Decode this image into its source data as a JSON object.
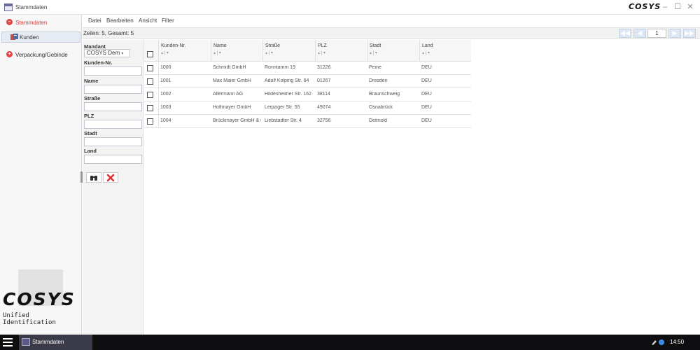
{
  "window": {
    "title": "Stammdaten",
    "brand": "COSYS",
    "minimize": "–",
    "maximize": "☐",
    "close": "✕"
  },
  "nav": {
    "stammdaten": "Stammdaten",
    "kunden": "Kunden",
    "verpackung": "Verpackung/Gebinde"
  },
  "logo": {
    "text": "COSYS",
    "sub": "Unified Identification"
  },
  "menu": [
    "Datei",
    "Bearbeiten",
    "Ansicht",
    "Filter"
  ],
  "info": {
    "rows": "Zeilen: 5, Gesamt: 5"
  },
  "pager": {
    "first": "◀◀",
    "prev": "◀",
    "page": "1",
    "next": "▶",
    "last": "▶▶"
  },
  "filter": {
    "mandant_label": "Mandant",
    "mandant_value": "COSYS Dem",
    "fields": [
      "Kunden-Nr.",
      "Name",
      "Straße",
      "PLZ",
      "Stadt",
      "Land"
    ]
  },
  "table": {
    "columns": [
      "Kunden-Nr.",
      "Name",
      "Straße",
      "PLZ",
      "Stadt",
      "Land"
    ],
    "sort_glyph": "▴ | ▾",
    "rows": [
      [
        "1000",
        "Schmidt GmbH",
        "Ronntamm 19",
        "31226",
        "Peine",
        "DEU"
      ],
      [
        "1001",
        "Max Maier GmbH",
        "Adolf Kolping Str. 64",
        "01267",
        "Dresden",
        "DEU"
      ],
      [
        "1002",
        "Allermann AG",
        "Hildesheimer Str. 162",
        "38114",
        "Braunschweig",
        "DEU"
      ],
      [
        "1003",
        "Hoffmayer GmbH",
        "Leipziger Str. 55",
        "49074",
        "Osnabrück",
        "DEU"
      ],
      [
        "1004",
        "Brückmayer GmbH & Co",
        "Liebstadter Str. 4",
        "32756",
        "Detmold",
        "DEU"
      ]
    ]
  },
  "taskbar": {
    "app": "Stammdaten",
    "time": "14:50"
  },
  "colors": {
    "accent": "#e04545",
    "taskbar": "#0e0e10"
  }
}
